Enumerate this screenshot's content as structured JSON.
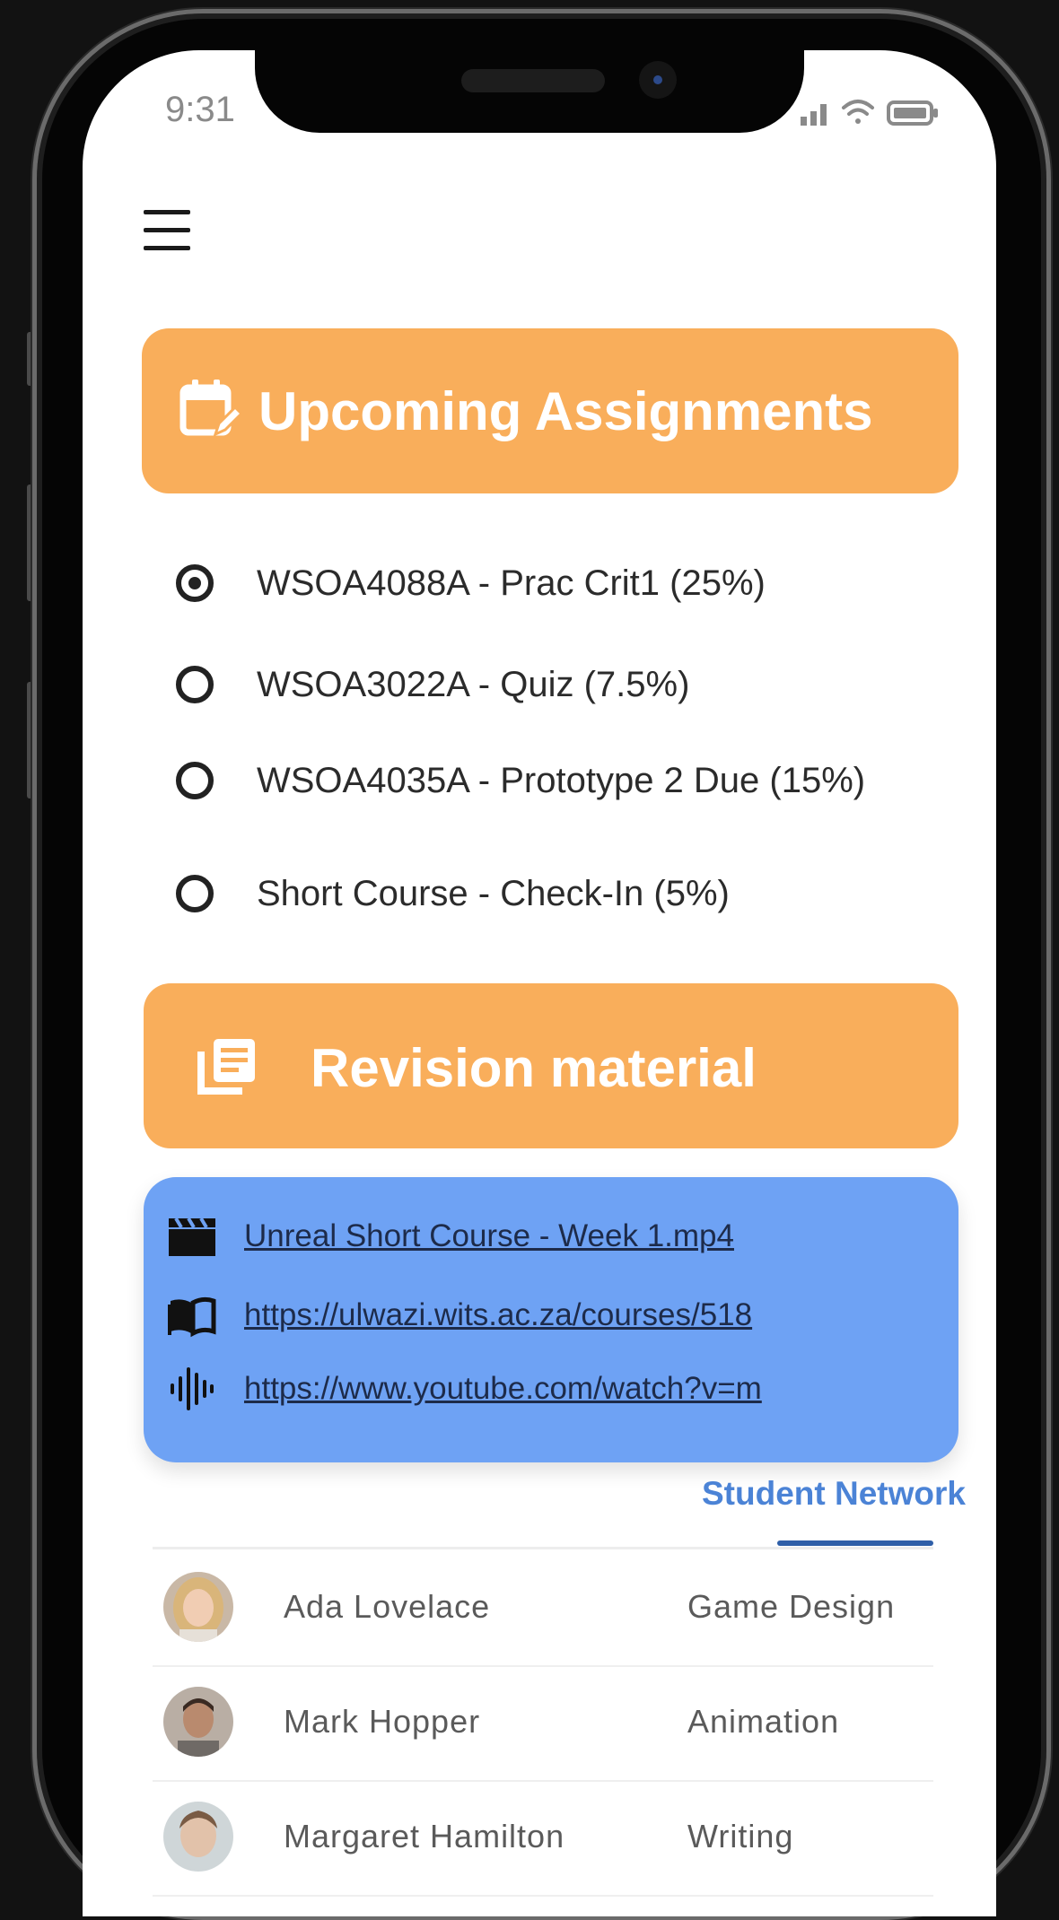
{
  "status_bar": {
    "time": "9:31"
  },
  "assignments": {
    "title": "Upcoming Assignments",
    "icon": "calendar-edit-icon",
    "items": [
      {
        "label": "WSOA4088A - Prac Crit1 (25%)",
        "checked": true
      },
      {
        "label": "WSOA3022A - Quiz (7.5%)",
        "checked": false
      },
      {
        "label": "WSOA4035A - Prototype 2 Due (15%)",
        "checked": false
      },
      {
        "label": "Short Course - Check-In (5%)",
        "checked": false
      }
    ]
  },
  "revision": {
    "title": "Revision material",
    "icon": "library-books-icon",
    "resources": [
      {
        "icon": "film-clapper-icon",
        "text": "Unreal Short Course - Week 1.mp4"
      },
      {
        "icon": "open-book-icon",
        "text": "https://ulwazi.wits.ac.za/courses/518"
      },
      {
        "icon": "audio-wave-icon",
        "text": "https://www.youtube.com/watch?v=m"
      }
    ]
  },
  "network": {
    "tab_label": "Student Network",
    "rows": [
      {
        "name": "Ada Lovelace",
        "field": "Game Design"
      },
      {
        "name": "Mark Hopper",
        "field": "Animation"
      },
      {
        "name": "Margaret Hamilton",
        "field": "Writing"
      }
    ]
  },
  "colors": {
    "orange_card": "#f9ae5b",
    "blue_card": "#6ea2f4",
    "tab_accent": "#4b83d6"
  }
}
